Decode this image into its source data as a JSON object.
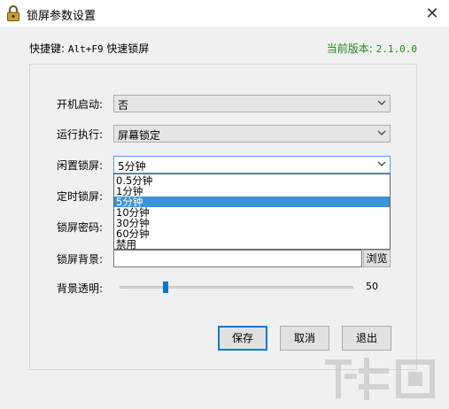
{
  "window": {
    "title": "锁屏参数设置",
    "close_glyph": "✕"
  },
  "header": {
    "hotkey_label": "快捷键: ",
    "hotkey_value": "Alt+F9",
    "hotkey_desc": " 快速锁屏",
    "version_label": "当前版本: ",
    "version_value": "2.1.0.0",
    "version_color": "#1d8a1d"
  },
  "form": {
    "startup": {
      "label": "开机启动:",
      "value": "否"
    },
    "run_action": {
      "label": "运行执行:",
      "value": "屏幕锁定"
    },
    "idle_lock": {
      "label": "闲置锁屏:",
      "value": "5分钟",
      "options": [
        "0.5分钟",
        "1分钟",
        "5分钟",
        "10分钟",
        "30分钟",
        "60分钟",
        "禁用"
      ],
      "selected_index": 2
    },
    "timed_lock": {
      "label": "定时锁屏:"
    },
    "lock_password": {
      "label": "锁屏密码:"
    },
    "lock_background": {
      "label": "锁屏背景:",
      "value": "",
      "browse_label": "浏览"
    },
    "transparency": {
      "label": "背景透明:",
      "value": 50,
      "min": 0,
      "max": 255
    }
  },
  "buttons": {
    "save": "保存",
    "cancel": "取消",
    "exit": "退出"
  },
  "colors": {
    "accent": "#0078d7",
    "selection": "#3c94d6"
  },
  "icons": {
    "app": "padlock-icon",
    "chevron": "chevron-down-icon"
  }
}
